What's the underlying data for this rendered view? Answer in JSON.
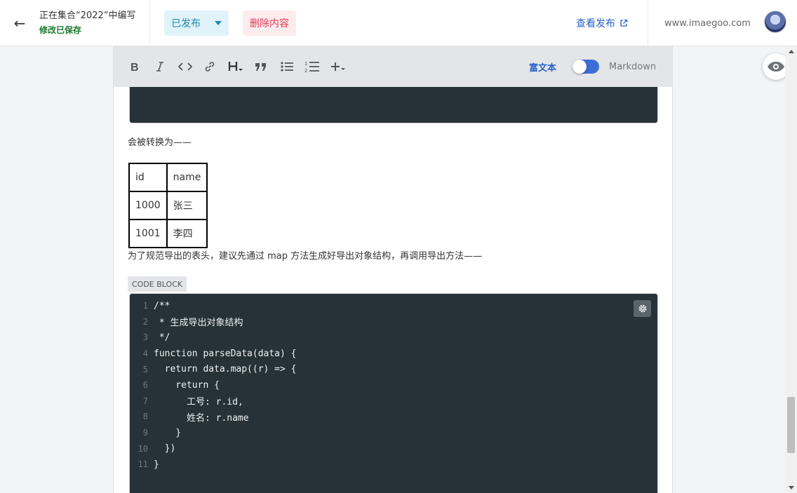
{
  "header": {
    "back_icon": "arrow-left-icon",
    "title": "正在集合“2022”中编写",
    "save_status": "修改已保存",
    "publish_status": "已发布",
    "delete_label": "删除内容",
    "view_published_label": "查看发布",
    "site": "www.imaegoo.com"
  },
  "toolbar": {
    "buttons": [
      "bold-icon",
      "italic-icon",
      "code-icon",
      "link-icon",
      "heading-icon",
      "quote-icon",
      "bullet-list-icon",
      "numbered-list-icon",
      "insert-plus-icon"
    ],
    "rich_text_label": "富文本",
    "markdown_label": "Markdown"
  },
  "content": {
    "para1": "会被转换为——",
    "table": [
      [
        "id",
        "name"
      ],
      [
        "1000",
        "张三"
      ],
      [
        "1001",
        "李四"
      ]
    ],
    "para2": "为了规范导出的表头，建议先通过 map 方法生成好导出对象结构，再调用导出方法——",
    "code_block_label": "CODE BLOCK",
    "code_lines": [
      "/**",
      " * 生成导出对象结构",
      " */",
      "function parseData(data) {",
      "  return data.map((r) => {",
      "    return {",
      "      工号: r.id,",
      "      姓名: r.name",
      "    }",
      "  })",
      "}"
    ]
  },
  "colors": {
    "accent": "#2763c9",
    "saved_green": "#1b7a2f",
    "publish_bg": "#e0f3f8",
    "delete_bg": "#fdecee",
    "delete_text": "#e23c55",
    "code_bg": "#263238"
  }
}
